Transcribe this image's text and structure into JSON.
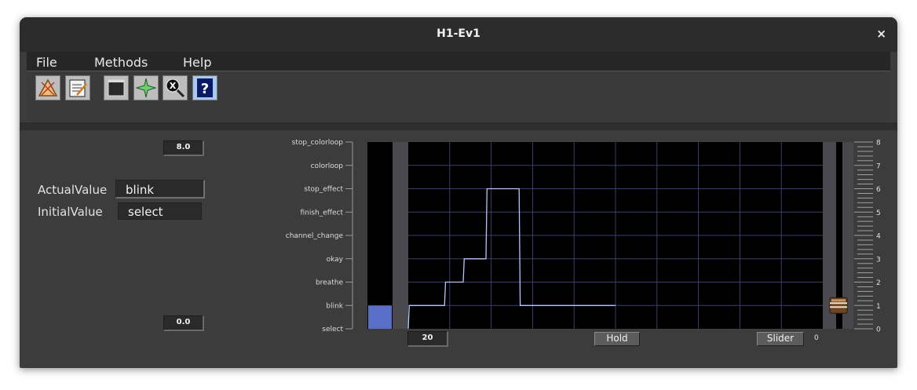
{
  "window": {
    "title": "H1-Ev1",
    "close_label": "×"
  },
  "menu": {
    "items": [
      "File",
      "Methods",
      "Help"
    ]
  },
  "toolbar": {
    "icons": [
      "triangle-icon",
      "notepad-icon",
      "window-icon",
      "star-icon",
      "inspect-icon",
      "help-icon"
    ]
  },
  "panel": {
    "max_value": "8.0",
    "min_value": "0.0",
    "actual_label": "ActualValue",
    "actual_value": "blink",
    "initial_label": "InitialValue",
    "initial_value": "select",
    "window_size": "20",
    "hold_label": "Hold",
    "slider_label": "Slider",
    "slider_value": "0"
  },
  "chart_data": {
    "type": "line",
    "y_labels": [
      "select",
      "blink",
      "breathe",
      "okay",
      "channel_change",
      "finish_effect",
      "stop_effect",
      "colorloop",
      "stop_colorloop"
    ],
    "ylim": [
      0,
      8
    ],
    "xlim": [
      0,
      20
    ],
    "points": [
      [
        0,
        0
      ],
      [
        0.05,
        1
      ],
      [
        1.75,
        1
      ],
      [
        1.8,
        2
      ],
      [
        2.65,
        2
      ],
      [
        2.7,
        3
      ],
      [
        3.75,
        3
      ],
      [
        3.8,
        6
      ],
      [
        5.35,
        6
      ],
      [
        5.4,
        1
      ],
      [
        10,
        1
      ]
    ],
    "current_value": 1,
    "scale_ticks": [
      "0",
      "1",
      "2",
      "3",
      "4",
      "5",
      "6",
      "7",
      "8"
    ],
    "grid": true,
    "line_color": "#b8c4ff",
    "bar_color": "#5a6fc8"
  }
}
